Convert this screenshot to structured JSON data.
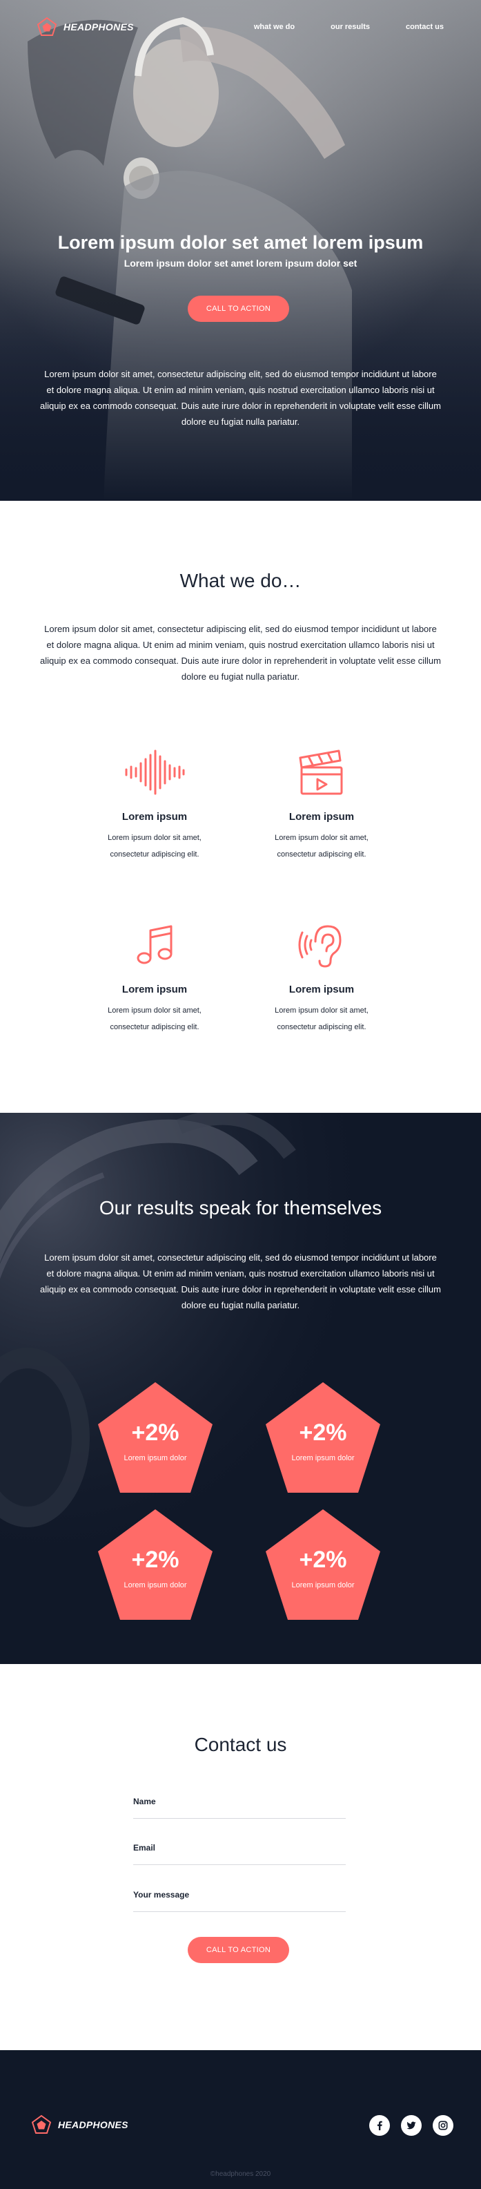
{
  "brand": {
    "name": "HEADPHONES"
  },
  "nav": {
    "items": [
      "what we do",
      "our results",
      "contact us"
    ]
  },
  "hero": {
    "title": "Lorem ipsum dolor set amet lorem ipsum",
    "subtitle": "Lorem ipsum dolor set amet lorem ipsum dolor set",
    "cta": "CALL TO ACTION",
    "paragraph": "Lorem ipsum dolor sit amet, consectetur adipiscing elit, sed do eiusmod tempor incididunt ut labore et dolore magna aliqua. Ut enim ad minim veniam, quis nostrud exercitation ullamco laboris nisi ut aliquip ex ea commodo consequat. Duis aute irure dolor in reprehenderit in voluptate velit esse cillum dolore eu fugiat nulla pariatur."
  },
  "what": {
    "title": "What we do…",
    "paragraph": "Lorem ipsum dolor sit amet, consectetur adipiscing elit, sed do eiusmod tempor incididunt ut labore et dolore magna aliqua. Ut enim ad minim veniam, quis nostrud exercitation ullamco laboris nisi ut aliquip ex ea commodo consequat. Duis aute irure dolor in reprehenderit in voluptate velit esse cillum dolore eu fugiat nulla pariatur.",
    "features": [
      {
        "icon": "soundwave-icon",
        "title": "Lorem ipsum",
        "line1": "Lorem ipsum dolor sit amet,",
        "line2": "consectetur adipiscing elit."
      },
      {
        "icon": "clapperboard-icon",
        "title": "Lorem ipsum",
        "line1": "Lorem ipsum dolor sit amet,",
        "line2": "consectetur adipiscing elit."
      },
      {
        "icon": "music-note-icon",
        "title": "Lorem ipsum",
        "line1": "Lorem ipsum dolor sit amet,",
        "line2": "consectetur adipiscing elit."
      },
      {
        "icon": "ear-icon",
        "title": "Lorem ipsum",
        "line1": "Lorem ipsum dolor sit amet,",
        "line2": "consectetur adipiscing elit."
      }
    ]
  },
  "results": {
    "title": "Our results speak for themselves",
    "paragraph": "Lorem ipsum dolor sit amet, consectetur adipiscing elit, sed do eiusmod tempor incididunt ut labore et dolore magna aliqua. Ut enim ad minim veniam, quis nostrud exercitation ullamco laboris nisi ut aliquip ex ea commodo consequat. Duis aute irure dolor in reprehenderit in voluptate velit esse cillum dolore eu fugiat nulla pariatur.",
    "stats": [
      {
        "value": "+2%",
        "label": "Lorem ipsum dolor"
      },
      {
        "value": "+2%",
        "label": "Lorem ipsum dolor"
      },
      {
        "value": "+2%",
        "label": "Lorem ipsum dolor"
      },
      {
        "value": "+2%",
        "label": "Lorem ipsum dolor"
      }
    ]
  },
  "contact": {
    "title": "Contact us",
    "fields": [
      {
        "label": "Name"
      },
      {
        "label": "Email"
      },
      {
        "label": "Your message"
      }
    ],
    "cta": "CALL TO ACTION"
  },
  "footer": {
    "social": [
      "facebook-icon",
      "twitter-icon",
      "instagram-icon"
    ],
    "copyright": "©headphones 2020"
  },
  "colors": {
    "accent": "#ff6b68",
    "dark": "#101828",
    "text": "#1c2433",
    "white": "#ffffff"
  }
}
